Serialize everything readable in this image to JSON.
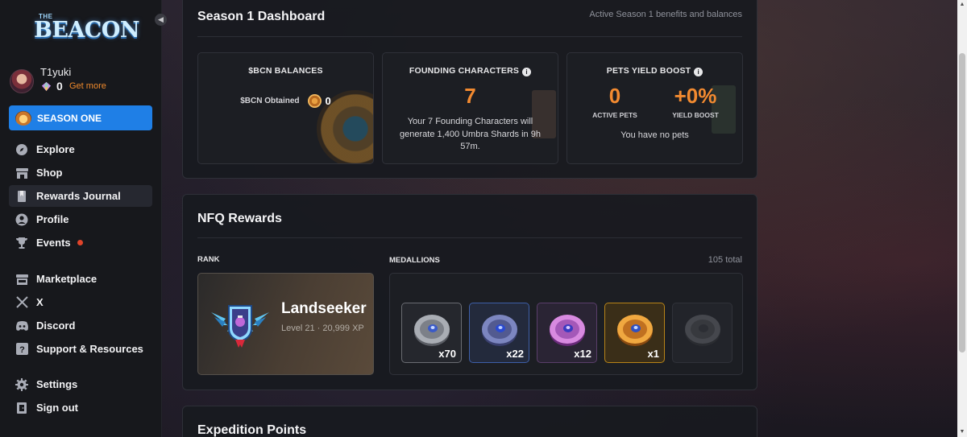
{
  "brand": {
    "small": "THE",
    "name": "BEACON"
  },
  "user": {
    "name": "T1yuki",
    "balance": "0",
    "get_more": "Get more"
  },
  "season_button": {
    "label": "SEASON ONE"
  },
  "nav": {
    "group1": [
      {
        "label": "Explore",
        "icon": "compass-icon"
      },
      {
        "label": "Shop",
        "icon": "store-icon"
      },
      {
        "label": "Rewards Journal",
        "icon": "journal-icon",
        "active": true
      },
      {
        "label": "Profile",
        "icon": "user-icon"
      },
      {
        "label": "Events",
        "icon": "trophy-icon",
        "badge": "notification-dot"
      }
    ],
    "group2": [
      {
        "label": "Marketplace",
        "icon": "marketplace-icon"
      },
      {
        "label": "X",
        "icon": "x-icon"
      },
      {
        "label": "Discord",
        "icon": "discord-icon"
      },
      {
        "label": "Support & Resources",
        "icon": "help-icon"
      }
    ],
    "group3": [
      {
        "label": "Settings",
        "icon": "gear-icon"
      },
      {
        "label": "Sign out",
        "icon": "sign-out-icon"
      }
    ]
  },
  "dashboard": {
    "title": "Season 1 Dashboard",
    "subtitle": "Active Season 1 benefits and balances",
    "bcn": {
      "heading": "$BCN BALANCES",
      "label": "$BCN Obtained",
      "value": "0"
    },
    "founding": {
      "heading": "FOUNDING CHARACTERS",
      "value": "7",
      "text": "Your 7 Founding Characters will generate 1,400 Umbra Shards in 9h 57m."
    },
    "pets": {
      "heading": "PETS YIELD BOOST",
      "active_value": "0",
      "active_label": "ACTIVE PETS",
      "boost_value": "+0%",
      "boost_label": "YIELD BOOST",
      "empty_text": "You have no pets"
    }
  },
  "nfq": {
    "title": "NFQ Rewards",
    "rank_label": "RANK",
    "rank": {
      "name": "Landseeker",
      "meta": "Level 21 · 20,999 XP"
    },
    "medallions_label": "MEDALLIONS",
    "total": "105 total",
    "medallions": [
      {
        "tier": "silver",
        "qty": "x70"
      },
      {
        "tier": "blue",
        "qty": "x22"
      },
      {
        "tier": "purple",
        "qty": "x12"
      },
      {
        "tier": "gold",
        "qty": "x1"
      },
      {
        "tier": "empty",
        "qty": ""
      }
    ]
  },
  "expedition": {
    "title": "Expedition Points"
  },
  "colors": {
    "accent_blue": "#1f7fe6",
    "accent_orange": "#f28a30",
    "sidebar_bg": "#17181c"
  }
}
